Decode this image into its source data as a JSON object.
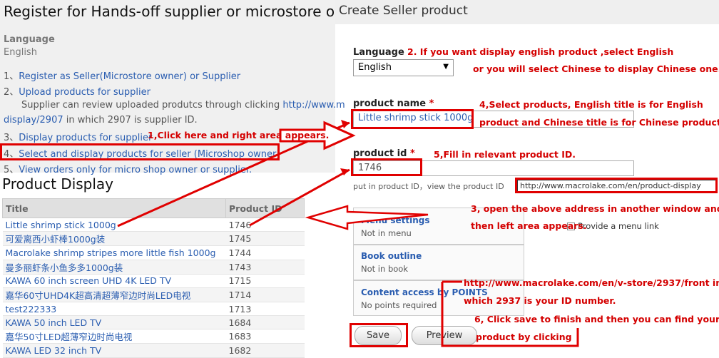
{
  "left": {
    "title": "Register for Hands-off supplier or microstore owner",
    "language_label": "Language",
    "language_value": "English",
    "steps": [
      {
        "num": "1、",
        "link": "Register as Seller(Microstore owner) or Supplier"
      },
      {
        "num": "2、",
        "link": "Upload products for supplier"
      },
      {
        "num": "3、",
        "link": "Display products for supplier"
      },
      {
        "num": "4、",
        "link": "Select and display products for seller (Microshop owner)"
      },
      {
        "num": "5、",
        "link": "View orders only for micro shop owner or supplier."
      }
    ],
    "step2_sub_text": "Supplier can review uploaded produtcs through clicking ",
    "step2_sub_link": "http://www.m",
    "step2_sub_line2_link": "display/2907",
    "step2_sub_line2_text": " in which 2907 is supplier ID."
  },
  "product_display": {
    "title": "Product Display",
    "columns": [
      "Title",
      "Product ID"
    ],
    "rows": [
      {
        "title": "Little shrimp stick 1000g",
        "id": "1746"
      },
      {
        "title": "可爱离西小虾棒1000g装",
        "id": "1745"
      },
      {
        "title": "Macrolake shrimp stripes more little fish 1000g",
        "id": "1744"
      },
      {
        "title": "曼多丽虾条小鱼多多1000g装",
        "id": "1743"
      },
      {
        "title": "KAWA 60 inch screen UHD 4K LED TV",
        "id": "1715"
      },
      {
        "title": "嘉华60寸UHD4K超高清超薄窄边时尚LED电视",
        "id": "1714"
      },
      {
        "title": "test222333",
        "id": "1713"
      },
      {
        "title": "KAWA 50 inch LED TV",
        "id": "1684"
      },
      {
        "title": "嘉华50寸LED超薄窄边时尚电视",
        "id": "1683"
      },
      {
        "title": "KAWA LED 32 inch TV",
        "id": "1682"
      }
    ]
  },
  "right": {
    "title": "Create Seller product",
    "language_label": "Language",
    "language_value": "English",
    "product_name_label": "product name",
    "product_name_value": "Little shrimp stick 1000g",
    "product_id_label": "product id",
    "product_id_value": "1746",
    "help_text": "put in product ID，view the product ID",
    "help_url": "http://www.macrolake.com/en/product-display",
    "menu_settings_title": "Menu settings",
    "menu_settings_sub": "Not in menu",
    "provide_menu_link": "Provide a menu link",
    "book_outline_title": "Book outline",
    "book_outline_sub": "Not in book",
    "content_access_title": "Content access by POINTS",
    "content_access_sub": "No points required",
    "save_label": "Save",
    "preview_label": "Preview",
    "required_mark": "*"
  },
  "annotations": {
    "a1": "1,Click here and right area appears.",
    "a2_line1": "2. If you want display english product ,select English",
    "a2_line2": "or you will select Chinese to display Chinese one.",
    "a3_line1": "3, open the above address in another window and",
    "a3_line2": "then left area appears.",
    "a4_line1": "4,Select products, English title is for English",
    "a4_line2": "product and Chinese title is for Chinese product",
    "a5": "5,Fill in relevant product ID.",
    "a6_url_line1": "http://www.macrolake.com/en/v-store/2937/front in",
    "a6_url_line2": "which 2937 is your ID number.",
    "a6_line1": "6, Click save to finish and then you can find your",
    "a6_line2": "product by clicking"
  },
  "colors": {
    "annotation_red": "#e00000",
    "link_blue": "#2a5db0"
  }
}
